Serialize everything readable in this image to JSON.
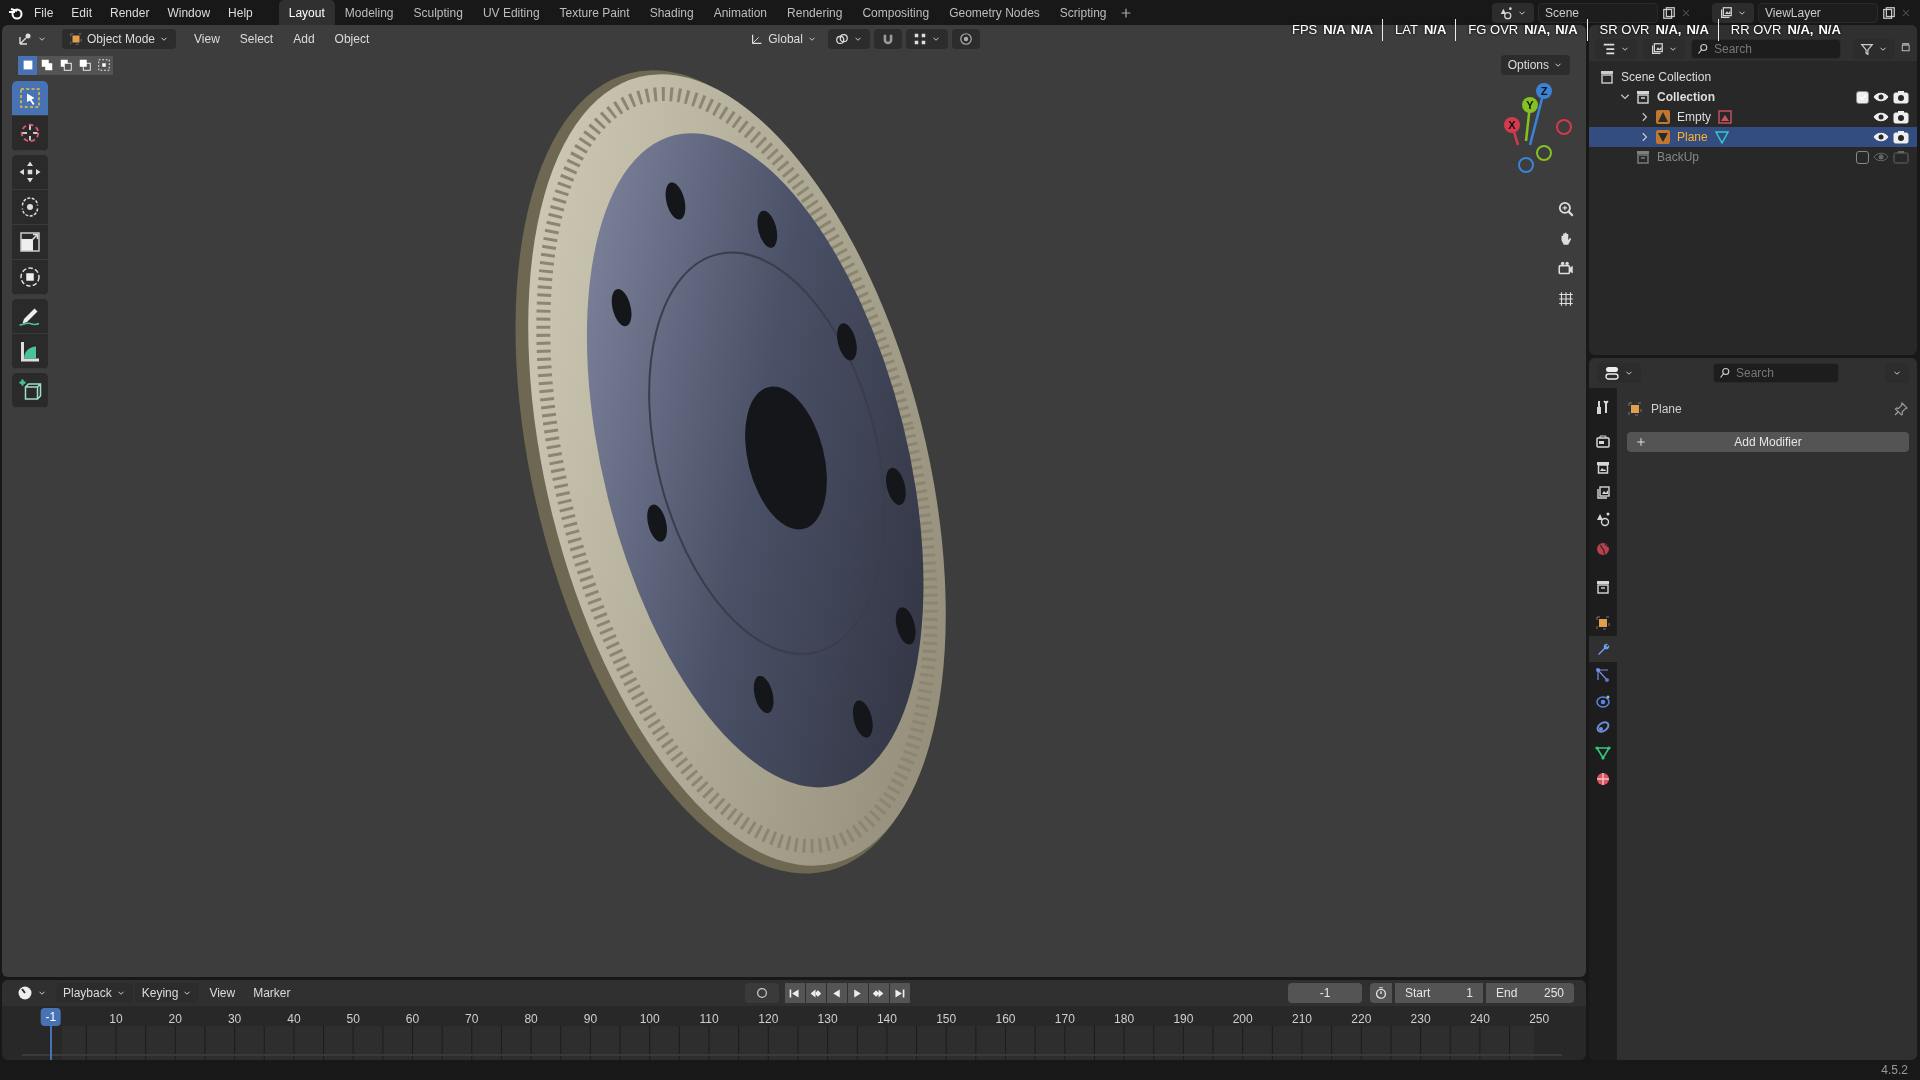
{
  "top_menu": [
    "File",
    "Edit",
    "Render",
    "Window",
    "Help"
  ],
  "workspaces": [
    {
      "label": "Layout",
      "selected": true
    },
    {
      "label": "Modeling",
      "selected": false
    },
    {
      "label": "Sculpting",
      "selected": false
    },
    {
      "label": "UV Editing",
      "selected": false
    },
    {
      "label": "Texture Paint",
      "selected": false
    },
    {
      "label": "Shading",
      "selected": false
    },
    {
      "label": "Animation",
      "selected": false
    },
    {
      "label": "Rendering",
      "selected": false
    },
    {
      "label": "Compositing",
      "selected": false
    },
    {
      "label": "Geometry Nodes",
      "selected": false
    },
    {
      "label": "Scripting",
      "selected": false
    }
  ],
  "scene": {
    "name": "Scene"
  },
  "view_layer": {
    "name": "ViewLayer"
  },
  "viewport": {
    "mode": "Object Mode",
    "menus": [
      "View",
      "Select",
      "Add",
      "Object"
    ],
    "orientation": "Global",
    "select_modes": [
      {
        "kind": "set",
        "selected": true
      },
      {
        "kind": "extend",
        "selected": false
      },
      {
        "kind": "subtract",
        "selected": false
      },
      {
        "kind": "difference",
        "selected": false
      },
      {
        "kind": "intersect",
        "selected": false
      }
    ],
    "options": "Options",
    "tool_groups": [
      [
        {
          "kind": "select_box",
          "selected": true
        },
        {
          "kind": "cursor",
          "selected": false
        }
      ],
      [
        {
          "kind": "move",
          "selected": false
        },
        {
          "kind": "rotate",
          "selected": false
        },
        {
          "kind": "scale",
          "selected": false
        },
        {
          "kind": "transform",
          "selected": false
        }
      ],
      [
        {
          "kind": "annotate",
          "selected": false
        },
        {
          "kind": "measure",
          "selected": false
        }
      ],
      [
        {
          "kind": "add_cube",
          "selected": false
        }
      ]
    ],
    "stats": [
      {
        "label": "FPS",
        "values": [
          "N/A",
          "N/A"
        ]
      },
      {
        "label": "LAT",
        "values": [
          "N/A"
        ]
      },
      {
        "label": "FG OVR",
        "values": [
          "N/A,",
          "N/A"
        ]
      },
      {
        "label": "SR OVR",
        "values": [
          "N/A,",
          "N/A"
        ]
      },
      {
        "label": "RR OVR",
        "values": [
          "N/A,",
          "N/A"
        ]
      }
    ],
    "gizmo_axes": [
      {
        "label": "X",
        "color": "#d33a4c"
      },
      {
        "label": "Y",
        "color": "#84c121"
      },
      {
        "label": "Z",
        "color": "#3b83d6"
      }
    ],
    "nav_buttons": [
      {
        "kind": "zoom"
      },
      {
        "kind": "pan"
      },
      {
        "kind": "camera"
      },
      {
        "kind": "ortho"
      }
    ]
  },
  "outliner": {
    "search": {
      "placeholder": "Search"
    },
    "tree": [
      {
        "label": "Scene Collection",
        "kind": "scene_collection",
        "children": [
          {
            "label": "Collection",
            "kind": "collection",
            "expanded": true,
            "checked": true,
            "disabled": false,
            "children": [
              {
                "label": "Empty",
                "kind": "empty",
                "expanded": false,
                "selected": false
              },
              {
                "label": "Plane",
                "kind": "mesh",
                "expanded": false,
                "selected": true
              }
            ]
          },
          {
            "label": "BackUp",
            "kind": "collection",
            "checked": false,
            "disabled": true
          }
        ]
      }
    ]
  },
  "properties": {
    "search": {
      "placeholder": "Search"
    },
    "tabs": [
      {
        "kind": "tool",
        "selected": false
      },
      {
        "kind": "render",
        "selected": false
      },
      {
        "kind": "output",
        "selected": false
      },
      {
        "kind": "view_layer",
        "selected": false
      },
      {
        "kind": "scene",
        "selected": false
      },
      {
        "kind": "world",
        "selected": false
      },
      {
        "kind": "collection",
        "selected": false
      },
      {
        "kind": "object",
        "selected": false
      },
      {
        "kind": "modifiers",
        "selected": true
      },
      {
        "kind": "particles",
        "selected": false
      },
      {
        "kind": "physics",
        "selected": false
      },
      {
        "kind": "constraints",
        "selected": false
      },
      {
        "kind": "data",
        "selected": false
      },
      {
        "kind": "material",
        "selected": false
      }
    ],
    "object_name": "Plane",
    "add_button": "Add Modifier"
  },
  "timeline": {
    "menus": [
      {
        "label": "Playback",
        "kind": "dropdown"
      },
      {
        "label": "Keying",
        "kind": "dropdown"
      },
      {
        "label": "View",
        "kind": "menu"
      },
      {
        "label": "Marker",
        "kind": "menu"
      }
    ],
    "current_frame": "-1",
    "start_label": "Start",
    "start": "1",
    "end_label": "End",
    "end": "250",
    "playhead": "-1",
    "ticks": [
      "10",
      "20",
      "30",
      "40",
      "50",
      "60",
      "70",
      "80",
      "90",
      "100",
      "110",
      "120",
      "130",
      "140",
      "150",
      "160",
      "170",
      "180",
      "190",
      "200",
      "210",
      "220",
      "230",
      "240",
      "250"
    ]
  },
  "version": "4.5.2"
}
